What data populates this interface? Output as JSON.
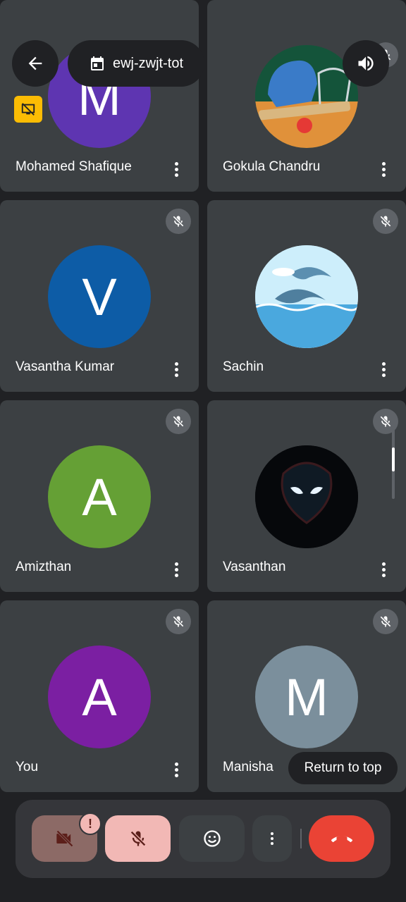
{
  "header": {
    "meeting_code": "ewj-zwjt-tot",
    "back_icon": "arrow-left-icon",
    "calendar_icon": "calendar-icon",
    "speaker_icon": "volume-up-icon"
  },
  "participants": [
    {
      "name": "Mohamed Shafique",
      "initial": "M",
      "color": "#5e35b1"
    },
    {
      "name": "Gokula Chandru",
      "initial": "",
      "image": "cricket-gear-photo"
    },
    {
      "name": "Vasantha Kumar",
      "initial": "V",
      "color": "#0d5ca6"
    },
    {
      "name": "Sachin",
      "initial": "",
      "image": "dolphins-illustration"
    },
    {
      "name": "Amizthan",
      "initial": "A",
      "color": "#65a035"
    },
    {
      "name": "Vasanthan",
      "initial": "",
      "image": "dark-superhero-photo"
    },
    {
      "name": "You",
      "initial": "A",
      "color": "#7b1fa2"
    },
    {
      "name": "Manisha",
      "initial": "M",
      "color": "#7b8f9c"
    }
  ],
  "return_to_top": "Return to top",
  "controls": {
    "camera_icon": "videocam-off-icon",
    "camera_badge": "!",
    "mic_icon": "mic-off-icon",
    "reactions_icon": "emoji-icon",
    "more_icon": "more-vertical-icon",
    "end_call_icon": "call-end-icon"
  },
  "colors": {
    "end_call": "#ea4335",
    "mic_off_bg": "#f2b8b5",
    "camera_off_bg": "#8c6a66",
    "presenting_badge": "#fbbc04"
  }
}
